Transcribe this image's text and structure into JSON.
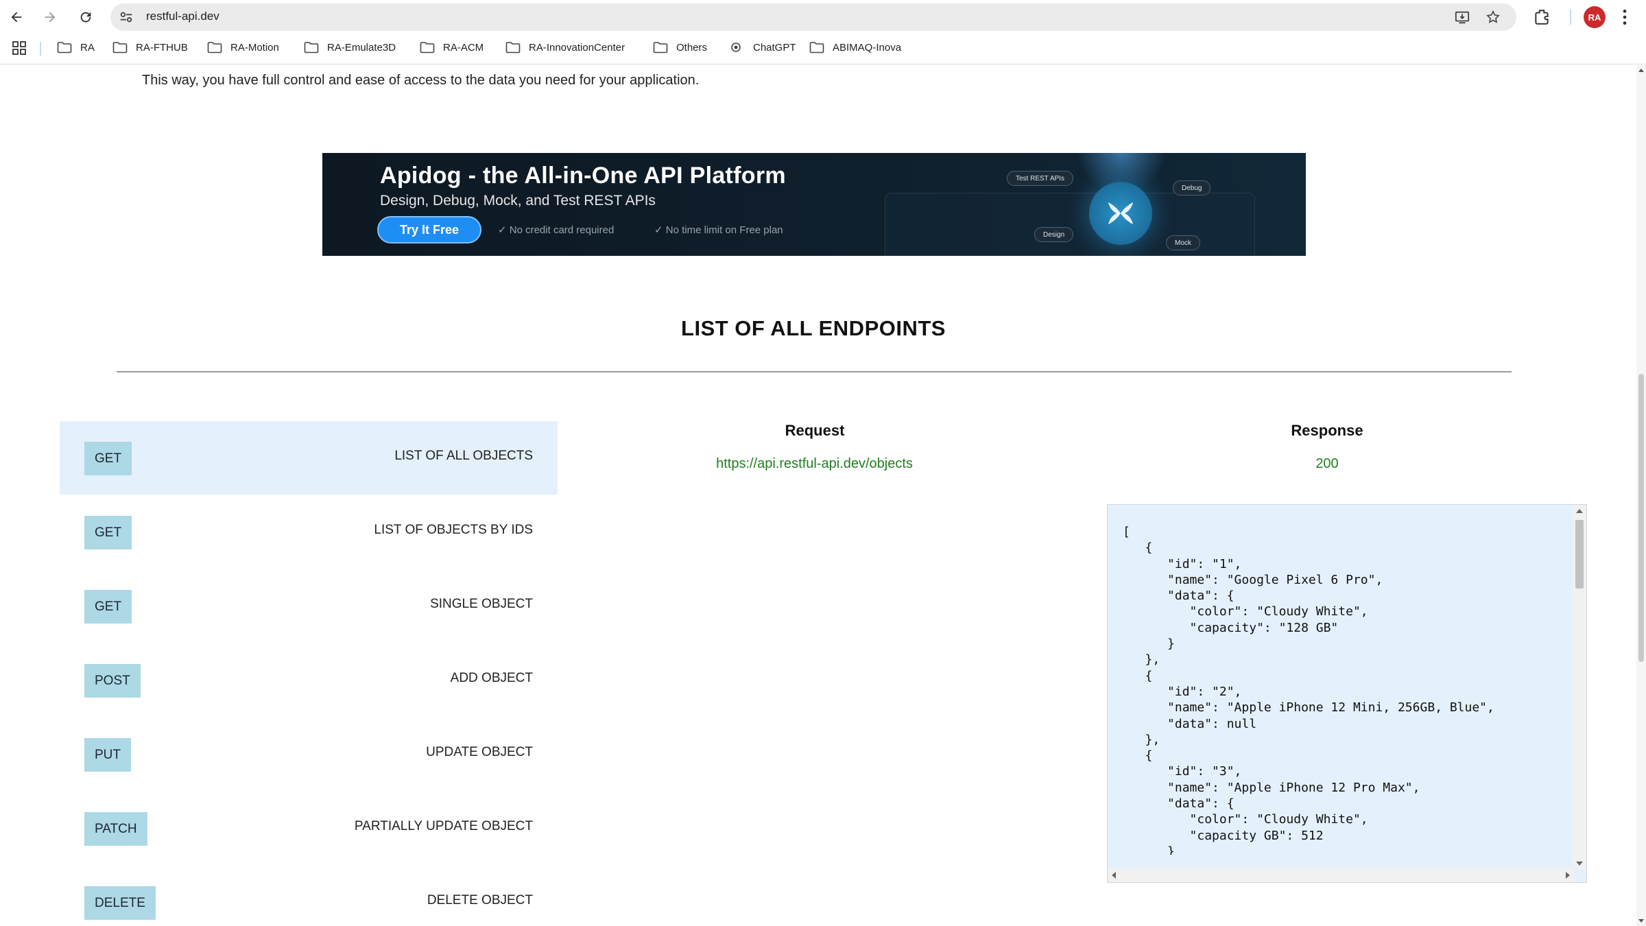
{
  "browser": {
    "url": "restful-api.dev",
    "profile_initials": "RA",
    "icons": {
      "back": "back-arrow-icon",
      "forward": "forward-arrow-icon",
      "reload": "reload-icon",
      "site_info": "site-info-icon",
      "install": "install-app-icon",
      "bookmark": "star-icon",
      "extensions": "extensions-icon",
      "menu": "kebab-menu-icon"
    },
    "bookmarks": [
      {
        "label": "RA",
        "icon": "folder-icon"
      },
      {
        "label": "RA-FTHUB",
        "icon": "folder-icon"
      },
      {
        "label": "RA-Motion",
        "icon": "folder-icon"
      },
      {
        "label": "RA-Emulate3D",
        "icon": "folder-icon"
      },
      {
        "label": "RA-ACM",
        "icon": "folder-icon"
      },
      {
        "label": "RA-InnovationCenter",
        "icon": "folder-icon"
      },
      {
        "label": "Others",
        "icon": "folder-icon"
      },
      {
        "label": "ChatGPT",
        "icon": "chatgpt-icon"
      },
      {
        "label": "ABIMAQ-Inova",
        "icon": "folder-icon"
      }
    ]
  },
  "page": {
    "intro_text": "This way, you have full control and ease of access to the data you need for your application.",
    "ad": {
      "title": "Apidog - the All-in-One API Platform",
      "subtitle": "Design, Debug, Mock, and Test REST APIs",
      "cta": "Try It Free",
      "checks": [
        "No credit card required",
        "No time limit on Free plan"
      ],
      "pills": [
        "Test REST APIs",
        "Debug",
        "Design",
        "Mock"
      ]
    },
    "section_title": "LIST OF ALL ENDPOINTS",
    "endpoints": [
      {
        "method": "GET",
        "label": "LIST OF ALL OBJECTS",
        "active": true
      },
      {
        "method": "GET",
        "label": "LIST OF OBJECTS BY IDS",
        "active": false
      },
      {
        "method": "GET",
        "label": "SINGLE OBJECT",
        "active": false
      },
      {
        "method": "POST",
        "label": "ADD OBJECT",
        "active": false
      },
      {
        "method": "PUT",
        "label": "UPDATE OBJECT",
        "active": false
      },
      {
        "method": "PATCH",
        "label": "PARTIALLY UPDATE OBJECT",
        "active": false
      },
      {
        "method": "DELETE",
        "label": "DELETE OBJECT",
        "active": false
      }
    ],
    "request": {
      "title": "Request",
      "url": "https://api.restful-api.dev/objects"
    },
    "response": {
      "title": "Response",
      "status": "200",
      "body": "[\n   {\n      \"id\": \"1\",\n      \"name\": \"Google Pixel 6 Pro\",\n      \"data\": {\n         \"color\": \"Cloudy White\",\n         \"capacity\": \"128 GB\"\n      }\n   },\n   {\n      \"id\": \"2\",\n      \"name\": \"Apple iPhone 12 Mini, 256GB, Blue\",\n      \"data\": null\n   },\n   {\n      \"id\": \"3\",\n      \"name\": \"Apple iPhone 12 Pro Max\",\n      \"data\": {\n         \"color\": \"Cloudy White\",\n         \"capacity GB\": 512\n      }\n   },"
    }
  }
}
